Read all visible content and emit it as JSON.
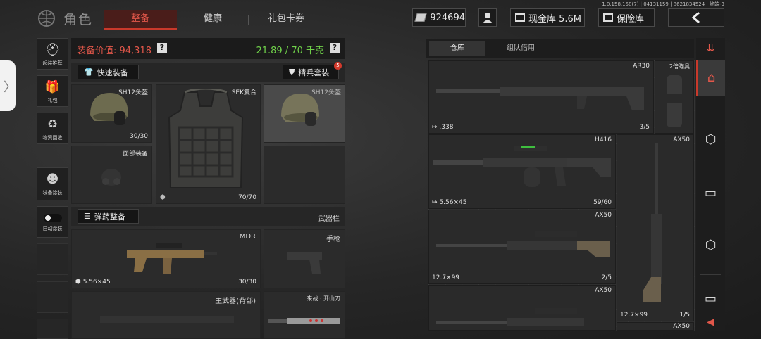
{
  "version": "1.0.158.158(7) | 04131159 | 8621834524 | 终端-3",
  "header": {
    "title": "角色",
    "tabs": [
      "整备",
      "健康",
      "礼包卡券"
    ],
    "money": "924694",
    "cash_vault": "现金库 5.6M",
    "safe": "保险库",
    "back_icon": "chevron-left-icon"
  },
  "sidebar": [
    {
      "label": "起装推荐",
      "icon": "helmet-recommend-icon"
    },
    {
      "label": "礼包",
      "icon": "gift-icon"
    },
    {
      "label": "物资回收",
      "icon": "recycle-icon"
    },
    {
      "label": "装备涂装",
      "icon": "paint-skin-icon"
    },
    {
      "label": "自动涂装",
      "icon": "toggle-icon"
    }
  ],
  "loadout": {
    "equip_value": "装备价值: 94,318",
    "weight": "21.89 / 70 千克",
    "quick_equip": "快速装备",
    "elite_kit": "精兵套装",
    "elite_badge": "5",
    "ammo_equip": "弹药整备",
    "weapon_bar": "武器栏",
    "slots": {
      "helmet": {
        "name": "SH12头盔",
        "count": "30/30"
      },
      "armor": {
        "name": "SEK复合",
        "count": "70/70"
      },
      "helmet2": {
        "name": "SH12头盔"
      },
      "face": {
        "name": "面部装备"
      },
      "primary": {
        "name": "MDR",
        "ammo": "5.56×45",
        "count": "30/30"
      },
      "pistol": {
        "name": "手枪"
      },
      "back": {
        "name": "主武器(背部)"
      },
      "melee": {
        "name": "来战 · 开山刀"
      }
    }
  },
  "storage": {
    "tabs": [
      "仓库",
      "组队借用"
    ],
    "items": [
      {
        "name": "AR30",
        "ammo": ".338",
        "count": "3/5"
      },
      {
        "name": "2倍瞄具"
      },
      {
        "name": "H416",
        "ammo": "5.56×45",
        "count": "59/60"
      },
      {
        "name": "AX50",
        "count": "1/5",
        "ammo": "12.7×99"
      },
      {
        "name": "AX50",
        "ammo": "12.7×99",
        "count": "2/5"
      },
      {
        "name": "AX50"
      },
      {
        "name": "AX50"
      }
    ]
  },
  "right_nav": [
    "sort-icon",
    "home-icon",
    "box-icon",
    "crate-icon",
    "box-icon",
    "crate-icon",
    "arrow-left-icon"
  ]
}
